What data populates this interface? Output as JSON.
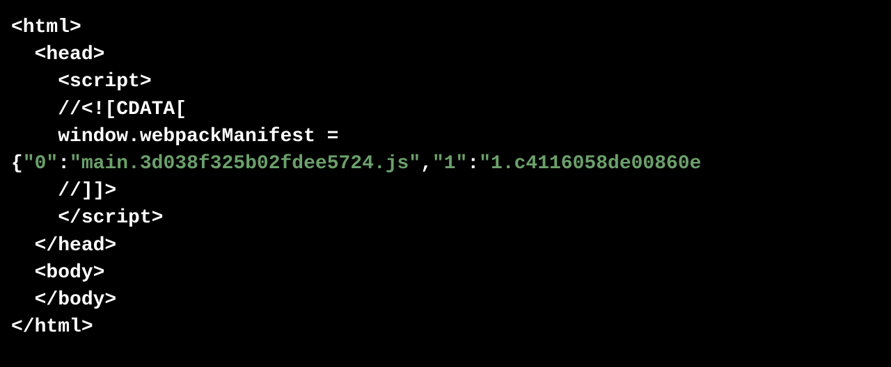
{
  "code": {
    "line1": "<html>",
    "line2": "  <head>",
    "line3": "    <script>",
    "line4": "    //<![CDATA[",
    "line5": "    window.webpackManifest =",
    "line6_open_brace": "{",
    "line6_key0": "\"0\"",
    "line6_colon": ":",
    "line6_val0": "\"main.3d038f325b02fdee5724.js\"",
    "line6_comma": ",",
    "line6_key1": "\"1\"",
    "line6_val1_partial": "\"1.c4116058de00860e",
    "line7": "    //]]>",
    "line8": "    </script>",
    "line9": "  </head>",
    "line10": "  <body>",
    "line11": "  </body>",
    "line12": "</html>"
  }
}
